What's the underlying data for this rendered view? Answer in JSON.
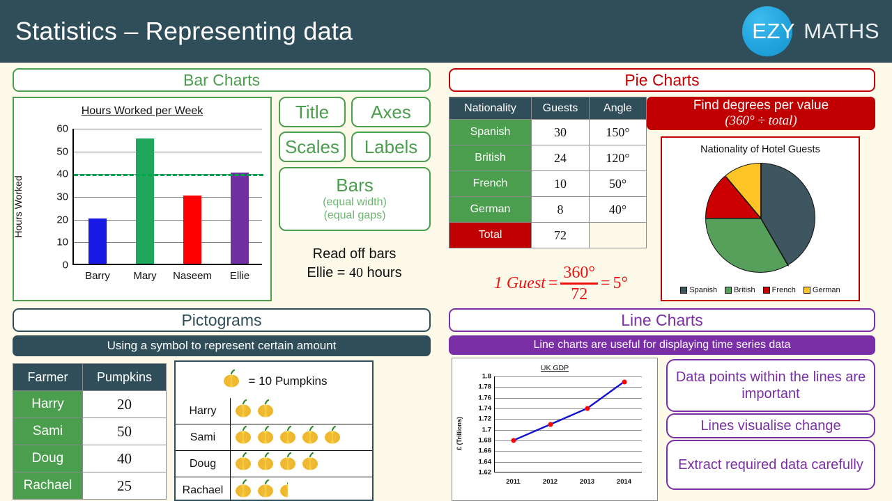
{
  "header": {
    "title": "Statistics – Representing data",
    "logo_ezy": "EZY",
    "logo_maths": "MATHS",
    "bg_color": "#2F4E59",
    "logo_circle_color": "#21A4DE"
  },
  "page": {
    "background_color": "#FEFAEA"
  },
  "sections": {
    "bar_charts": {
      "title": "Bar Charts",
      "accent_color": "#4A9E4D",
      "feature_pills": [
        {
          "label": "Title"
        },
        {
          "label": "Axes"
        },
        {
          "label": "Scales"
        },
        {
          "label": "Labels"
        }
      ],
      "bars_pill": {
        "label": "Bars",
        "note1": "(equal width)",
        "note2": "(equal gaps)"
      },
      "read_off_line1": "Read off bars",
      "read_off_line2_name": "Ellie = ",
      "read_off_line2_value": "40",
      "read_off_line2_unit": " hours"
    },
    "pie_charts": {
      "title": "Pie Charts",
      "accent_color": "#C00000",
      "banner_line1": "Find degrees per value",
      "banner_line2": "(360° ÷ total)",
      "formula": {
        "lhs": "1 Guest",
        "equals": "=",
        "numerator": "360°",
        "denominator": "72",
        "equals2": "=",
        "result": "5°"
      }
    },
    "pictograms": {
      "title": "Pictograms",
      "accent_color": "#2F4E59",
      "banner": "Using a symbol to represent certain amount",
      "key_text": "= 10 Pumpkins",
      "key_icon": "pumpkin-icon"
    },
    "line_charts": {
      "title": "Line Charts",
      "accent_color": "#7A2FA6",
      "banner": "Line charts are useful for displaying time series data",
      "notes": [
        "Data points within the lines are important",
        "Lines visualise change",
        "Extract required data carefully"
      ]
    }
  },
  "pie_table": {
    "headers": [
      "Nationality",
      "Guests",
      "Angle"
    ],
    "rows": [
      {
        "nationality": "Spanish",
        "guests": "30",
        "angle": "150°"
      },
      {
        "nationality": "British",
        "guests": "24",
        "angle": "120°"
      },
      {
        "nationality": "French",
        "guests": "10",
        "angle": "50°"
      },
      {
        "nationality": "German",
        "guests": "8",
        "angle": "40°"
      }
    ],
    "total_label": "Total",
    "total_guests": "72"
  },
  "pictogram_table": {
    "headers": [
      "Farmer",
      "Pumpkins"
    ],
    "rows": [
      {
        "farmer": "Harry",
        "pumpkins": "20"
      },
      {
        "farmer": "Sami",
        "pumpkins": "50"
      },
      {
        "farmer": "Doug",
        "pumpkins": "40"
      },
      {
        "farmer": "Rachael",
        "pumpkins": "25"
      }
    ]
  },
  "pictogram_rows": [
    {
      "name": "Harry",
      "symbols": 2.0
    },
    {
      "name": "Sami",
      "symbols": 5.0
    },
    {
      "name": "Doug",
      "symbols": 4.0
    },
    {
      "name": "Rachael",
      "symbols": 2.5
    }
  ],
  "chart_data": [
    {
      "id": "bar-chart",
      "type": "bar",
      "title": "Hours Worked per Week",
      "xlabel": "",
      "ylabel": "Hours Worked",
      "categories": [
        "Barry",
        "Mary",
        "Naseem",
        "Ellie"
      ],
      "values": [
        20,
        55,
        30,
        40
      ],
      "colors": [
        "#1A1AE6",
        "#1FA85C",
        "#FF0000",
        "#7030A0"
      ],
      "ylim": [
        0,
        60
      ],
      "yticks": [
        0,
        10,
        20,
        30,
        40,
        50,
        60
      ],
      "grid": true,
      "legend": "none",
      "annotations": [
        {
          "type": "hline",
          "value": 40,
          "color": "#00A44B",
          "style": "dashed"
        }
      ]
    },
    {
      "id": "pie-chart",
      "type": "pie",
      "title": "Nationality of Hotel Guests",
      "labels": [
        "Spanish",
        "British",
        "French",
        "German"
      ],
      "values": [
        30,
        24,
        10,
        8
      ],
      "angles": [
        150,
        120,
        50,
        40
      ],
      "colors": [
        "#3E5660",
        "#57A05B",
        "#CC0000",
        "#FFC425"
      ],
      "legend": "bottom",
      "total": 72
    },
    {
      "id": "line-chart",
      "type": "line",
      "title": "UK GDP",
      "xlabel": "",
      "ylabel": "£ (Trillions)",
      "x": [
        "2011",
        "2012",
        "2013",
        "2014"
      ],
      "values": [
        1.68,
        1.71,
        1.74,
        1.79
      ],
      "ylim": [
        1.62,
        1.8
      ],
      "yticks": [
        1.62,
        1.64,
        1.66,
        1.68,
        1.7,
        1.72,
        1.74,
        1.76,
        1.78,
        1.8
      ],
      "grid": true,
      "line_color": "#1010D0",
      "marker_color": "#FF0000",
      "legend": "none"
    }
  ]
}
